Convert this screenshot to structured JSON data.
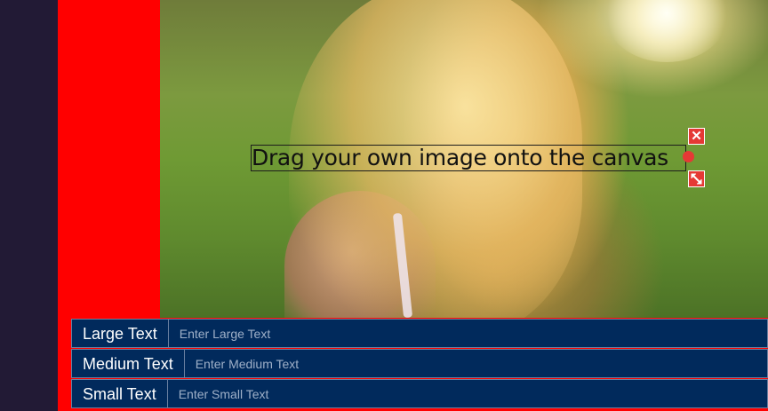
{
  "canvas": {
    "overlay_text": "Drag your own image onto the canvas",
    "delete_glyph": "✕"
  },
  "form": {
    "large": {
      "label": "Large Text",
      "placeholder": "Enter Large Text"
    },
    "medium": {
      "label": "Medium Text",
      "placeholder": "Enter Medium Text"
    },
    "small": {
      "label": "Small Text",
      "placeholder": "Enter Small Text"
    }
  },
  "colors": {
    "accent_red": "#ff0000",
    "control_red": "#e53935",
    "navy": "#012a5c",
    "rail": "#221a35"
  }
}
